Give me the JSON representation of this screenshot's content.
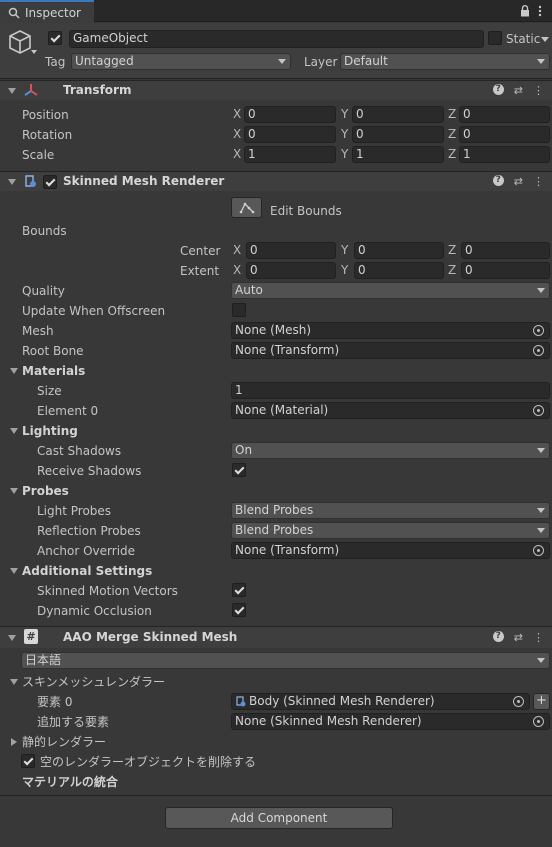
{
  "tab": {
    "title": "Inspector"
  },
  "gameobject": {
    "name": "GameObject",
    "static_label": "Static",
    "tag_label": "Tag",
    "tag_value": "Untagged",
    "layer_label": "Layer",
    "layer_value": "Default"
  },
  "transform": {
    "title": "Transform",
    "rows": [
      {
        "label": "Position",
        "x": "0",
        "y": "0",
        "z": "0"
      },
      {
        "label": "Rotation",
        "x": "0",
        "y": "0",
        "z": "0"
      },
      {
        "label": "Scale",
        "x": "1",
        "y": "1",
        "z": "1"
      }
    ],
    "axis": {
      "x": "X",
      "y": "Y",
      "z": "Z"
    }
  },
  "smr": {
    "title": "Skinned Mesh Renderer",
    "edit_bounds": "Edit Bounds",
    "bounds_label": "Bounds",
    "center_label": "Center",
    "extent_label": "Extent",
    "center": {
      "x": "0",
      "y": "0",
      "z": "0"
    },
    "extent": {
      "x": "0",
      "y": "0",
      "z": "0"
    },
    "quality_label": "Quality",
    "quality_value": "Auto",
    "offscreen_label": "Update When Offscreen",
    "mesh_label": "Mesh",
    "mesh_value": "None (Mesh)",
    "rootbone_label": "Root Bone",
    "rootbone_value": "None (Transform)",
    "materials_label": "Materials",
    "size_label": "Size",
    "size_value": "1",
    "element0_label": "Element 0",
    "element0_value": "None (Material)",
    "lighting_label": "Lighting",
    "cast_label": "Cast Shadows",
    "cast_value": "On",
    "receive_label": "Receive Shadows",
    "probes_label": "Probes",
    "light_probes_label": "Light Probes",
    "light_probes_value": "Blend Probes",
    "refl_probes_label": "Reflection Probes",
    "refl_probes_value": "Blend Probes",
    "anchor_label": "Anchor Override",
    "anchor_value": "None (Transform)",
    "additional_label": "Additional Settings",
    "motion_label": "Skinned Motion Vectors",
    "occlusion_label": "Dynamic Occlusion"
  },
  "aao": {
    "title": "AAO Merge Skinned Mesh",
    "language": "日本語",
    "smr_section": "スキンメッシュレンダラー",
    "element0_label": "要素 0",
    "element0_value": "Body (Skinned Mesh Renderer)",
    "add_element_label": "追加する要素",
    "add_element_value": "None (Skinned Mesh Renderer)",
    "static_section": "静的レンダラー",
    "remove_empty_label": "空のレンダラーオブジェクトを削除する",
    "merge_materials_label": "マテリアルの統合"
  },
  "footer": {
    "add_component": "Add Component"
  }
}
